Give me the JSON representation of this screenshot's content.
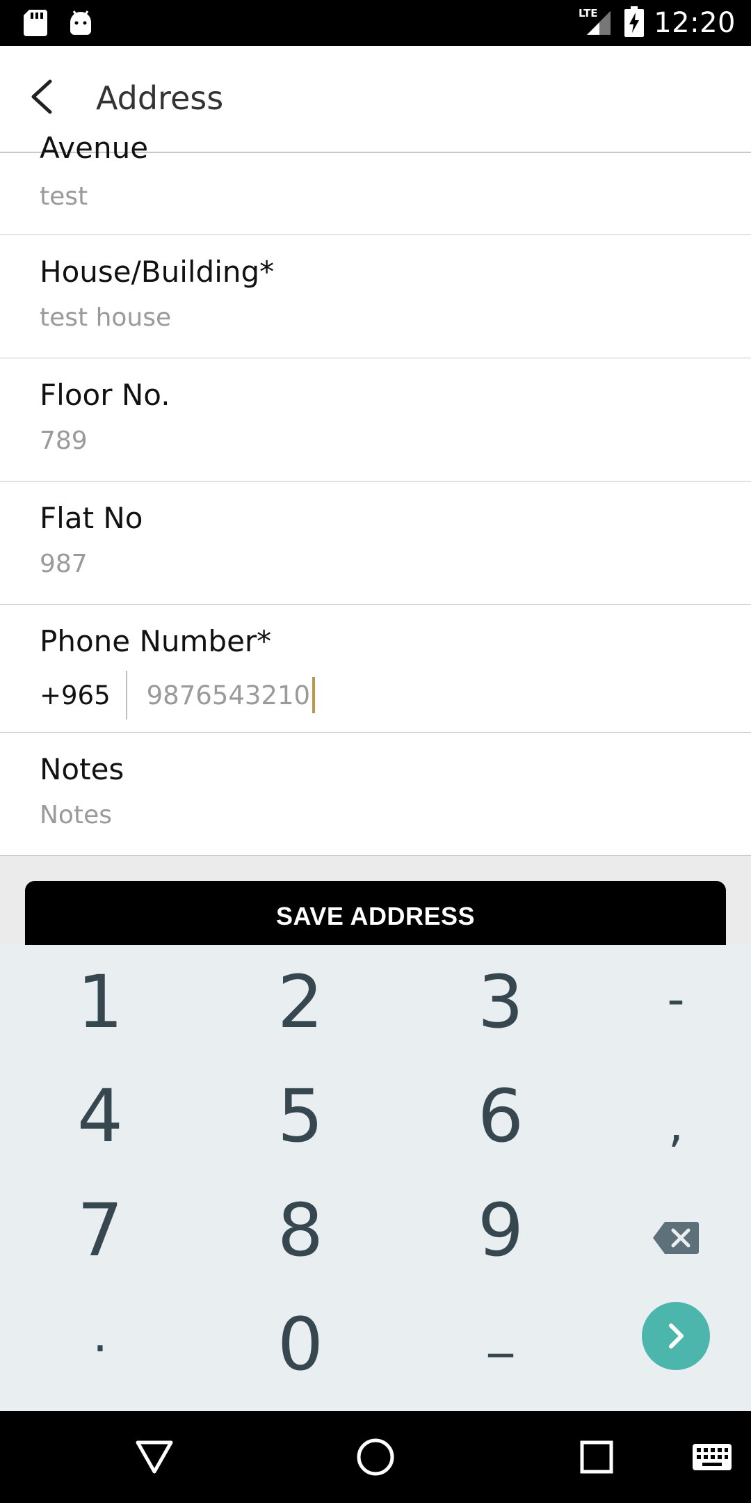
{
  "status_bar": {
    "time": "12:20",
    "network": "LTE",
    "icons": [
      "sd-card-icon",
      "android-icon",
      "lte-signal-icon",
      "battery-charging-icon"
    ]
  },
  "app_bar": {
    "title": "Address",
    "back_icon": "back-arrow-icon"
  },
  "form": {
    "avenue": {
      "label": "Avenue",
      "value": "test"
    },
    "house": {
      "label": "House/Building*",
      "value": "test house"
    },
    "floor": {
      "label": "Floor No.",
      "value": "789"
    },
    "flat": {
      "label": "Flat No",
      "value": "987"
    },
    "phone": {
      "label": "Phone Number*",
      "country_code": "+965",
      "value": "9876543210"
    },
    "notes": {
      "label": "Notes",
      "placeholder": "Notes"
    }
  },
  "save_button": {
    "label": "SAVE ADDRESS"
  },
  "keyboard": {
    "row1": [
      "1",
      "2",
      "3",
      "-"
    ],
    "row2": [
      "4",
      "5",
      "6",
      ","
    ],
    "row3": [
      "7",
      "8",
      "9"
    ],
    "row4": [
      ".",
      "0",
      "_"
    ],
    "backspace_icon": "backspace-icon",
    "next_icon": "next-arrow-icon",
    "accent_color": "#4db6ac"
  },
  "nav_bar": {
    "icons": [
      "back-triangle-icon",
      "home-circle-icon",
      "recents-square-icon",
      "keyboard-icon"
    ]
  }
}
